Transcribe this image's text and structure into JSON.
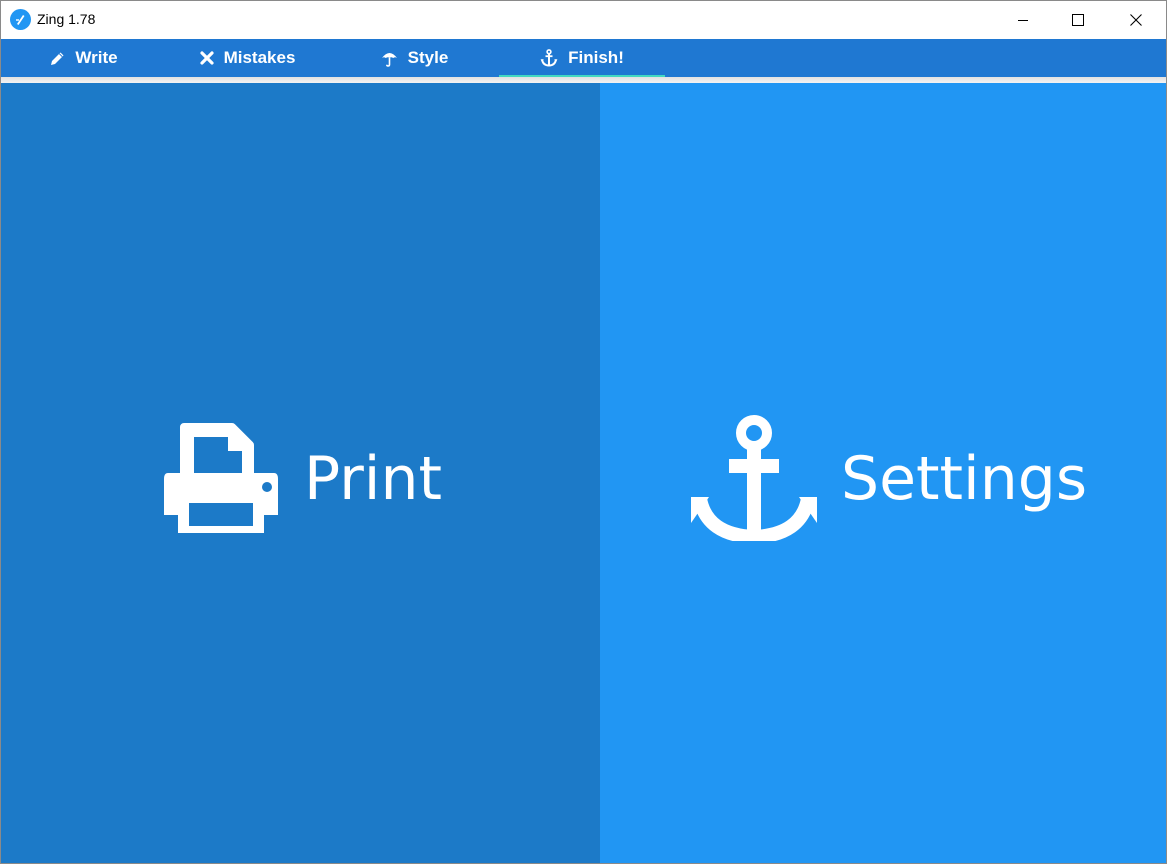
{
  "window": {
    "title": "Zing 1.78",
    "app_icon": "zing-logo-icon",
    "controls": [
      "minimize-icon",
      "maximize-icon",
      "close-icon"
    ]
  },
  "tabs": [
    {
      "label": "Write",
      "icon": "pencil-icon"
    },
    {
      "label": "Mistakes",
      "icon": "x-mark-icon"
    },
    {
      "label": "Style",
      "icon": "umbrella-icon"
    },
    {
      "label": "Finish!",
      "icon": "anchor-icon",
      "active": true
    }
  ],
  "panels": {
    "print": {
      "label": "Print",
      "icon": "printer-icon"
    },
    "settings": {
      "label": "Settings",
      "icon": "anchor-icon"
    }
  },
  "colors": {
    "tabbar": "#1f78d2",
    "tab_indicator": "#43d9c0",
    "print_panel": "#1c7ac8",
    "settings_panel": "#2196f3",
    "text": "#ffffff"
  }
}
